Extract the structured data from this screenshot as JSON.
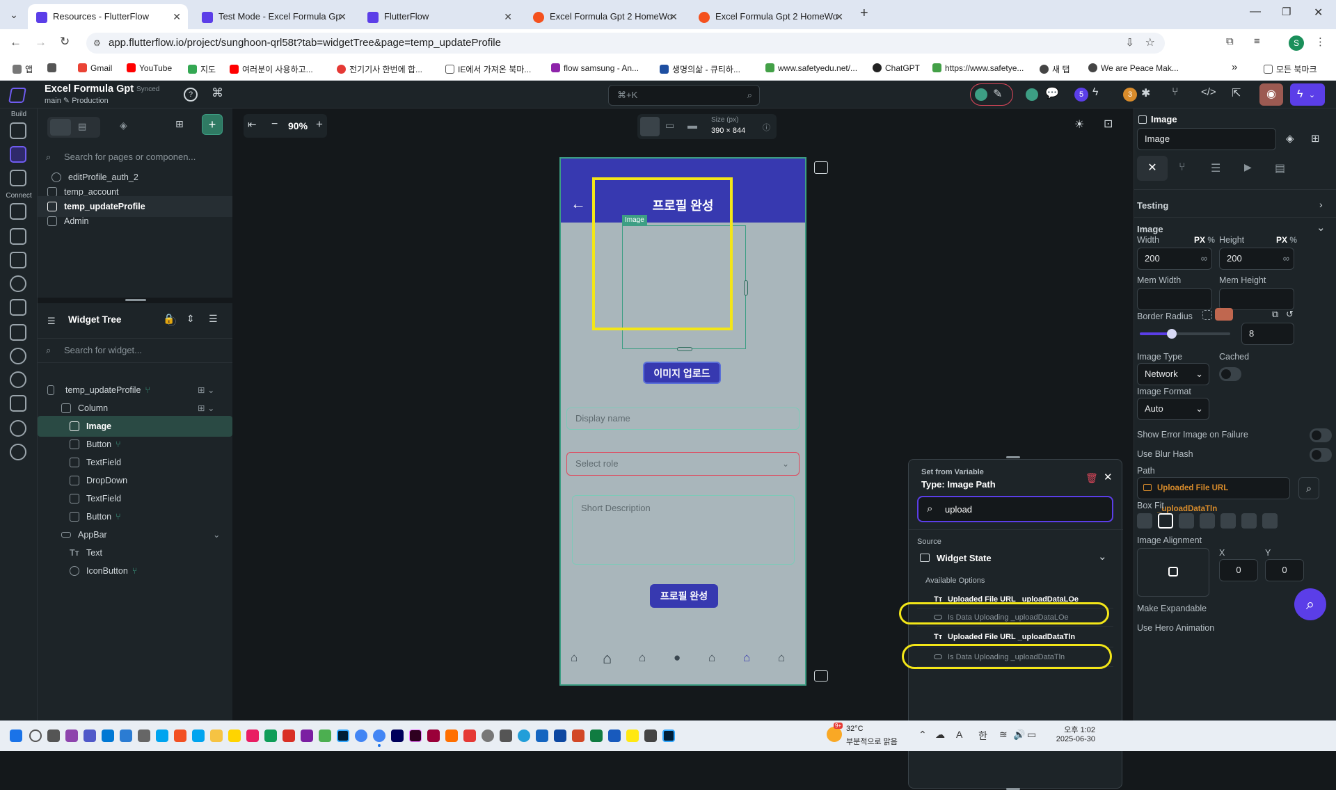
{
  "browser": {
    "tabs": [
      {
        "title": "Resources - FlutterFlow",
        "active": true,
        "color": "#5b3ee8"
      },
      {
        "title": "Test Mode - Excel Formula Gp",
        "active": false,
        "color": "#5b3ee8"
      },
      {
        "title": "FlutterFlow",
        "active": false,
        "color": "#5b3ee8"
      },
      {
        "title": "Excel Formula Gpt 2 HomeWo",
        "active": false,
        "color": "#f4511e"
      },
      {
        "title": "Excel Formula Gpt 2 HomeWo",
        "active": false,
        "color": "#f4511e"
      }
    ],
    "url": "app.flutterflow.io/project/sunghoon-qrl58t?tab=widgetTree&page=temp_updateProfile",
    "bookmarks": [
      "앱",
      "Gmail",
      "YouTube",
      "지도",
      "여러분이 사용하고...",
      "전기기사 한번에 합...",
      "IE에서 가져온 북마...",
      "flow samsung - An...",
      "생명의삶 - 큐티하...",
      "www.safetyedu.net/...",
      "ChatGPT",
      "https://www.safetye...",
      "새 탭",
      "We are Peace Mak..."
    ],
    "bookmarks_all": "모든 북마크",
    "profile_initial": "S"
  },
  "project": {
    "name": "Excel Formula Gpt",
    "status": "Synced",
    "branch": "main",
    "env": "Production",
    "search_shortcut": "⌘+K",
    "badge_count_1": "5",
    "badge_count_2": "3"
  },
  "rail": {
    "build_label": "Build",
    "connect_label": "Connect"
  },
  "pages_panel": {
    "search_placeholder": "Search for pages or componen...",
    "pages": [
      "editProfile_auth_2",
      "temp_account",
      "temp_updateProfile",
      "Admin"
    ]
  },
  "widget_tree": {
    "title": "Widget Tree",
    "search_placeholder": "Search for widget...",
    "items": [
      "temp_updateProfile",
      "Column",
      "Image",
      "Button",
      "TextField",
      "DropDown",
      "TextField",
      "Button",
      "AppBar",
      "Text",
      "IconButton"
    ]
  },
  "canvas": {
    "zoom": "90%",
    "size_label": "Size (px)",
    "size_value": "390 × 844"
  },
  "phone": {
    "title": "프로필 완성",
    "image_tag": "Image",
    "upload_button": "이미지 업로드",
    "display_name": "Display name",
    "select_role": "Select role",
    "short_description": "Short Description",
    "submit_button": "프로필 완성"
  },
  "popup": {
    "header": "Set from Variable",
    "type_label": "Type: Image Path",
    "search_value": "upload",
    "source_label": "Source",
    "source_value": "Widget State",
    "available_label": "Available Options",
    "options": [
      {
        "label": "Uploaded File URL _uploadDataLOe",
        "highlight": true
      },
      {
        "label": "Is Data Uploading _uploadDataLOe",
        "highlight": false
      },
      {
        "label": "Uploaded File URL _uploadDataTln",
        "highlight": true
      },
      {
        "label": "Is Data Uploading _uploadDataTln",
        "highlight": false
      }
    ]
  },
  "properties": {
    "widget_type": "Image",
    "widget_name": "Image",
    "testing": "Testing",
    "section": "Image",
    "width_label": "Width",
    "width_value": "200",
    "height_label": "Height",
    "height_value": "200",
    "unit": "PX",
    "unit_pct": "%",
    "min_width": "Mem Width",
    "min_height": "Mem Height",
    "border_radius_label": "Border Radius",
    "border_radius_value": "8",
    "border_radius_slider": 0.35,
    "image_type_label": "Image Type",
    "image_type_value": "Network",
    "cached_label": "Cached",
    "image_format_label": "Image Format",
    "image_format_value": "Auto",
    "show_error": "Show Error Image on Failure",
    "blur_hash": "Use Blur Hash",
    "path_label": "Path",
    "path_value": "Uploaded File URL _uploadDataTln",
    "box_fit": "Box Fit",
    "alignment": "Image Alignment",
    "x_label": "X",
    "x_value": "0",
    "y_label": "Y",
    "y_value": "0",
    "expandable": "Make Expandable",
    "hero": "Use Hero Animation"
  },
  "taskbar": {
    "temp": "32°C",
    "weather": "부분적으로 맑음",
    "badge": "9+",
    "time": "오후 1:02",
    "date": "2025-06-30",
    "lang": "한",
    "ime": "A"
  },
  "colors": {
    "accent": "#3739b0",
    "highlight": "#f3e618",
    "flutterflow_purple": "#5b3ee8",
    "teal": "#3d9e84",
    "danger": "#e0475b"
  }
}
